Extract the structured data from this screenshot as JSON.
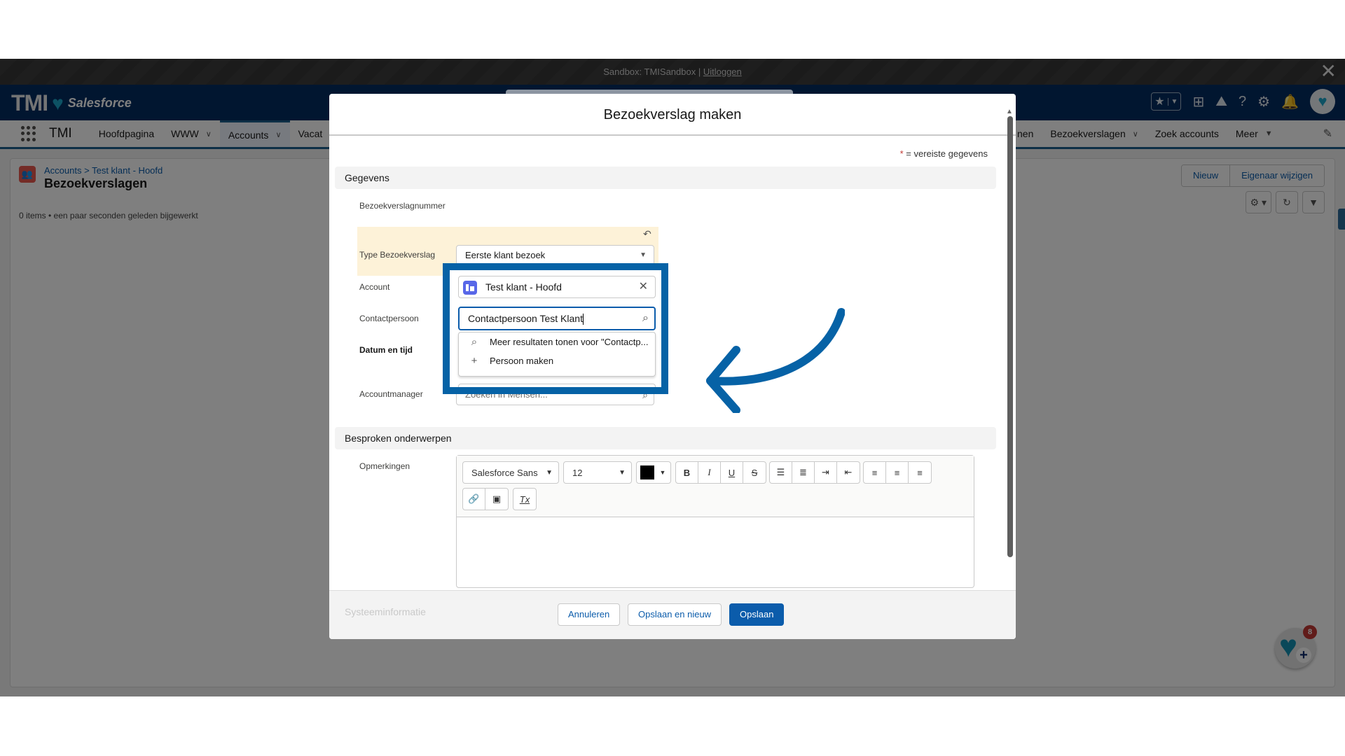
{
  "sandbox_bar": {
    "text": "Sandbox: TMISandbox |",
    "logout_link": "Uitloggen",
    "close_icon": "✕"
  },
  "header": {
    "brand_short": "TMI",
    "brand_name": "Salesforce"
  },
  "nav": {
    "app_name": "TMI",
    "items": [
      {
        "label": "Hoofdpagina",
        "has_menu": false
      },
      {
        "label": "WWW",
        "has_menu": true
      },
      {
        "label": "Accounts",
        "has_menu": true,
        "active": true
      },
      {
        "label": "Vacat",
        "has_menu": false
      }
    ],
    "right_items": [
      {
        "label": "nen"
      },
      {
        "label": "Bezoekverslagen",
        "has_menu": true
      },
      {
        "label": "Zoek accounts"
      },
      {
        "label": "Meer",
        "has_menu": true
      }
    ]
  },
  "page": {
    "breadcrumb_1": "Accounts",
    "breadcrumb_sep": ">",
    "breadcrumb_2": "Test klant - Hoofd",
    "title": "Bezoekverslagen",
    "meta": "0 items • een paar seconden geleden bijgewerkt",
    "buttons": {
      "new": "Nieuw",
      "change_owner": "Eigenaar wijzigen"
    }
  },
  "fab": {
    "badge": "8"
  },
  "modal": {
    "title": "Bezoekverslag maken",
    "required_note": "= vereiste gegevens",
    "required_star": "*",
    "section_details": "Gegevens",
    "fields": {
      "number_label": "Bezoekverslagnummer",
      "type_label": "Type Bezoekverslag",
      "type_value": "Eerste klant bezoek",
      "account_label": "Account",
      "account_value": "Test klant - Hoofd",
      "contact_label": "Contactpersoon",
      "contact_value": "Contactpersoon Test Klant",
      "datetime_label": "Datum en tijd",
      "manager_label": "Accountmanager",
      "manager_placeholder": "Zoeken in Mensen..."
    },
    "lookup_dropdown": [
      {
        "icon": "search-icon",
        "label": "Meer resultaten tonen voor \"Contactp..."
      },
      {
        "icon": "plus-icon",
        "label": "Persoon maken"
      }
    ],
    "section_topics": "Besproken onderwerpen",
    "notes_label": "Opmerkingen",
    "rte": {
      "font": "Salesforce Sans",
      "size": "12",
      "text_color": "#000000"
    },
    "system_info": "Systeeminformatie",
    "buttons": {
      "cancel": "Annuleren",
      "save_new": "Opslaan en nieuw",
      "save": "Opslaan"
    }
  },
  "annotation": {
    "highlight_color": "#0662a6"
  }
}
